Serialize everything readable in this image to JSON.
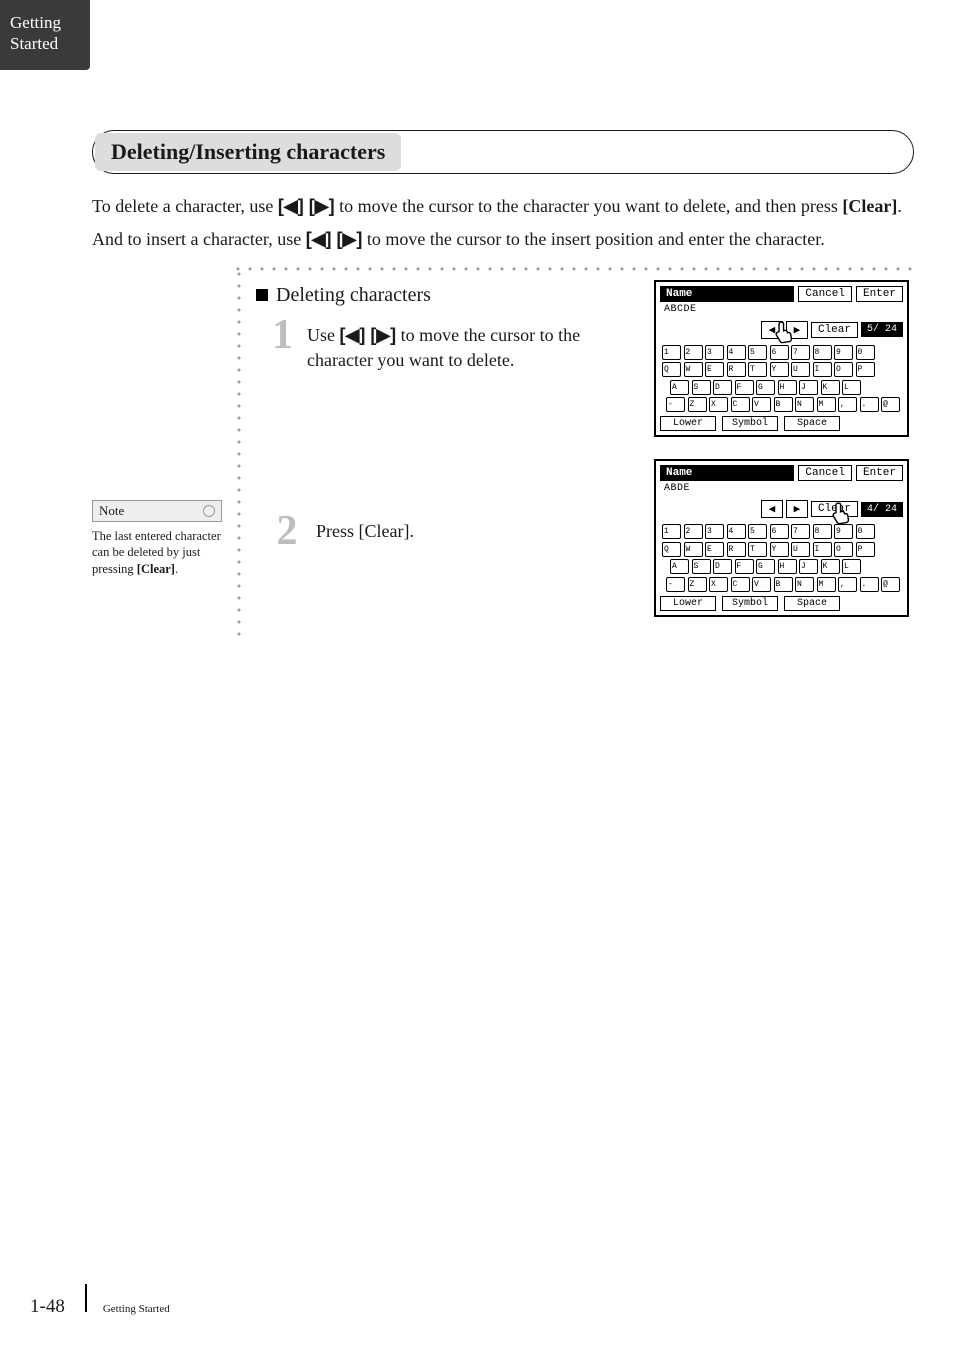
{
  "side_tab": {
    "line1": "Getting",
    "line2": "Started"
  },
  "heading": "Deleting/Inserting characters",
  "intro": {
    "p1_a": "To delete a character, use ",
    "p1_arrows": "[◀] [▶]",
    "p1_b": " to move the cursor to the character you want to delete, and then press ",
    "p1_clear": "[Clear]",
    "p1_c": ".",
    "p2_a": "And to insert a character, use ",
    "p2_arrows": "[◀] [▶]",
    "p2_b": " to move the cursor to the insert position and enter the character."
  },
  "sub_heading": "Deleting characters",
  "steps": {
    "s1_num": "1",
    "s1_a": "Use ",
    "s1_arrows": "[◀] [▶]",
    "s1_b": " to move the cursor to the character you want to delete.",
    "s2_num": "2",
    "s2_a": "Press ",
    "s2_clear": "[Clear]",
    "s2_b": "."
  },
  "note": {
    "label": "Note",
    "body_a": "The last entered character can be deleted by just pressing ",
    "body_clear": "[Clear]",
    "body_b": "."
  },
  "screen_labels": {
    "title": "Name",
    "cancel": "Cancel",
    "enter": "Enter",
    "clear": "Clear",
    "lower": "Lower",
    "symbol": "Symbol",
    "space": "Space",
    "arrow_left": "◀",
    "arrow_right": "▶"
  },
  "screen1": {
    "value": "ABCDE",
    "pos": "5/ 24"
  },
  "screen2": {
    "value": "ABDE",
    "pos": "4/ 24"
  },
  "keyboard": {
    "row1": [
      "1",
      "2",
      "3",
      "4",
      "5",
      "6",
      "7",
      "8",
      "9",
      "0"
    ],
    "row2": [
      "Q",
      "W",
      "E",
      "R",
      "T",
      "Y",
      "U",
      "I",
      "O",
      "P"
    ],
    "row3": [
      "A",
      "S",
      "D",
      "F",
      "G",
      "H",
      "J",
      "K",
      "L"
    ],
    "row4": [
      "-",
      "Z",
      "X",
      "C",
      "V",
      "B",
      "N",
      "M",
      ",",
      ".",
      "@"
    ]
  },
  "footer": {
    "page": "1-48",
    "section": "Getting Started"
  }
}
